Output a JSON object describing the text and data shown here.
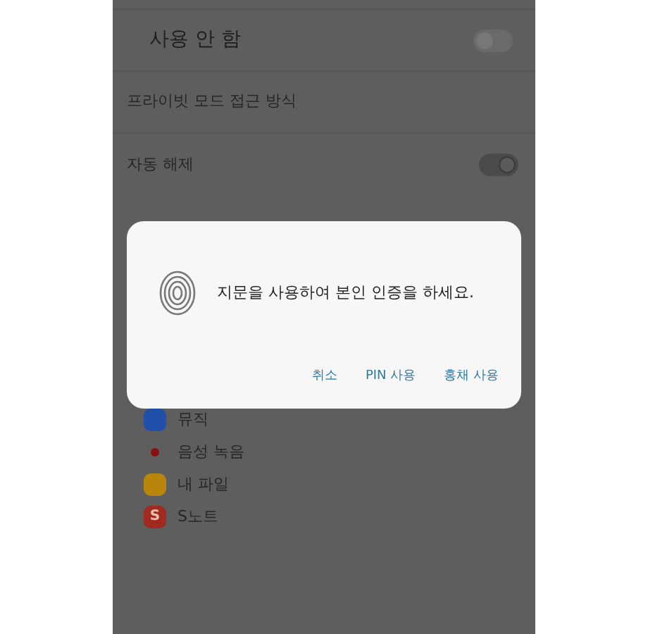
{
  "settings": [
    {
      "kind": "toggle",
      "title": "사용 안 함",
      "on": false
    },
    {
      "kind": "nav",
      "title": "프라이빗 모드 접근 방식"
    },
    {
      "kind": "toggle",
      "title": "자동 해제",
      "on": true
    }
  ],
  "dialog": {
    "message": "지문을 사용하여 본인 인증을 하세요.",
    "buttons": [
      "취소",
      "PIN 사용",
      "홍채 사용"
    ]
  },
  "apps": [
    {
      "name": "뮤직",
      "color": "#1f4fa8"
    },
    {
      "name": "음성 녹음",
      "color": "#8a1010",
      "kind": "dot"
    },
    {
      "name": "내 파일",
      "color": "#b8860b"
    },
    {
      "name": "S노트",
      "color": "#a02a20",
      "letter": "S"
    }
  ]
}
